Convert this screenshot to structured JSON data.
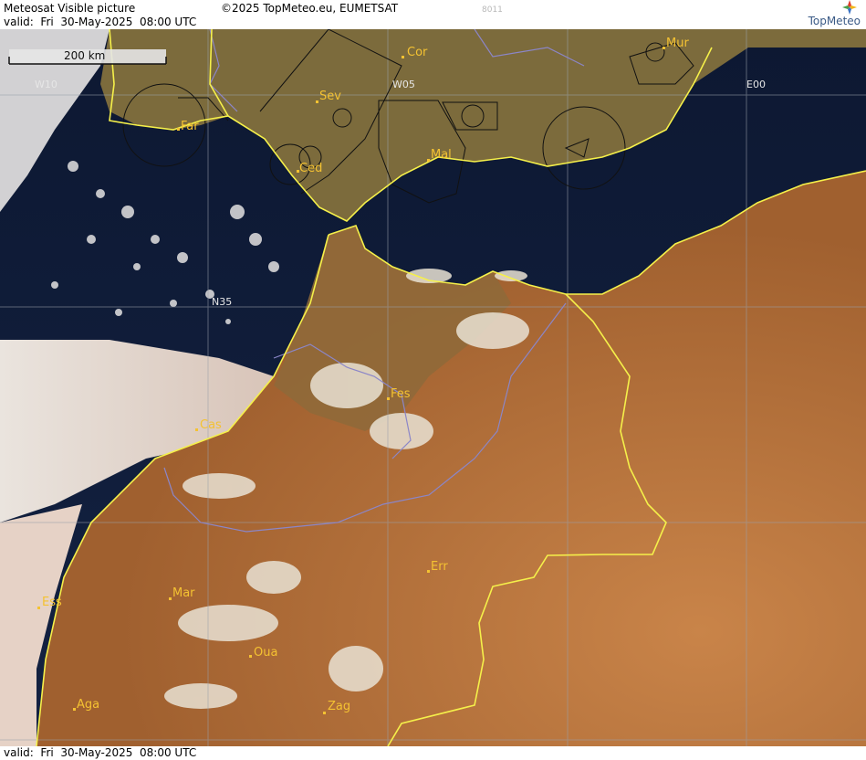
{
  "header": {
    "title": "Meteosat Visible picture",
    "copyright": "©2025 TopMeteo.eu, EUMETSAT",
    "code": "8011",
    "valid": "valid:  Fri  30-May-2025  08:00 UTC",
    "logo_text": "TopMeteo"
  },
  "footer": {
    "valid": "valid:  Fri  30-May-2025  08:00 UTC"
  },
  "map": {
    "scale_label": "200 km",
    "grid_labels": {
      "w10": "W10",
      "w05": "W05",
      "e00": "E00",
      "n35": "N35"
    },
    "cities": {
      "cor": "Cor",
      "mur": "Mur",
      "sev": "Sev",
      "far": "Far",
      "ced": "Ced",
      "mal": "Mal",
      "fes": "Fes",
      "cas": "Cas",
      "err": "Err",
      "mar": "Mar",
      "ess": "Ess",
      "oua": "Oua",
      "aga": "Aga",
      "zag": "Zag"
    },
    "colors": {
      "sea": "#0f1a33",
      "land_desert": "#b3703e",
      "land_iberia": "#7a6a3a",
      "border": "#f5f04a",
      "region_line": "#8b86c8",
      "city_label": "#f4c232",
      "grid": "#9aa0aa"
    }
  }
}
